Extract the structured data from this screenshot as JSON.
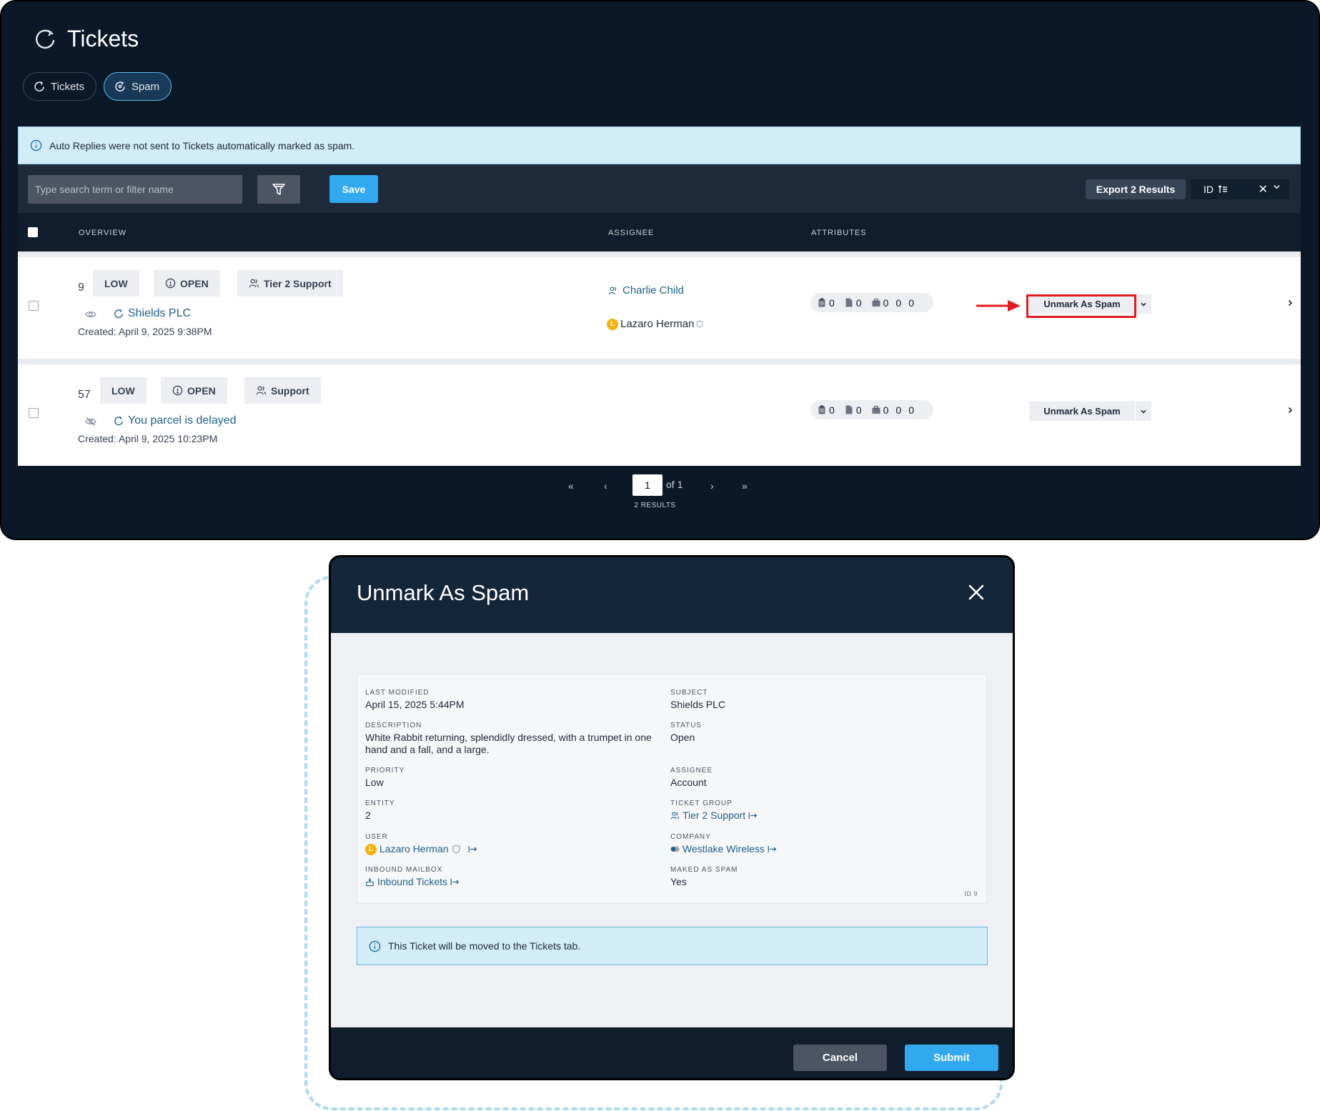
{
  "page": {
    "title": "Tickets"
  },
  "tabs": [
    {
      "label": "Tickets",
      "active": false
    },
    {
      "label": "Spam",
      "active": true
    }
  ],
  "banner": {
    "text": "Auto Replies were not sent to Tickets automatically marked as spam."
  },
  "toolbar": {
    "search_placeholder": "Type search term or filter name",
    "save_label": "Save",
    "export_label": "Export 2 Results",
    "sort_label": "ID"
  },
  "table": {
    "columns": {
      "overview": "OVERVIEW",
      "assignee": "ASSIGNEE",
      "attributes": "ATTRIBUTES"
    },
    "rows": [
      {
        "id": "9",
        "priority": "LOW",
        "status": "OPEN",
        "group": "Tier 2 Support",
        "subject": "Shields PLC",
        "created": "Created: April 9, 2025 9:38PM",
        "assignee": "Charlie Child",
        "user": "Lazaro Herman",
        "user_initial": "L",
        "attr": [
          "0",
          "0",
          "0",
          "0",
          "0"
        ],
        "action": "Unmark As Spam"
      },
      {
        "id": "57",
        "priority": "LOW",
        "status": "OPEN",
        "group": "Support",
        "subject": "You parcel is delayed",
        "created": "Created: April 9, 2025 10:23PM",
        "attr": [
          "0",
          "0",
          "0",
          "0",
          "0"
        ],
        "action": "Unmark As Spam"
      }
    ]
  },
  "pagination": {
    "page": "1",
    "of_label": "of 1",
    "results": "2 RESULTS"
  },
  "modal": {
    "title": "Unmark As Spam",
    "fields": {
      "last_modified": {
        "label": "LAST MODIFIED",
        "value": "April 15, 2025 5:44PM"
      },
      "subject": {
        "label": "SUBJECT",
        "value": "Shields PLC"
      },
      "description": {
        "label": "DESCRIPTION",
        "value": "White Rabbit returning, splendidly dressed, with a trumpet in one hand and a fall, and a large."
      },
      "status": {
        "label": "STATUS",
        "value": "Open"
      },
      "priority": {
        "label": "PRIORITY",
        "value": "Low"
      },
      "assignee": {
        "label": "ASSIGNEE",
        "value": "Account"
      },
      "entity": {
        "label": "ENTITY",
        "value": "2"
      },
      "ticket_group": {
        "label": "TICKET GROUP",
        "value": "Tier 2 Support"
      },
      "user": {
        "label": "USER",
        "value": "Lazaro Herman",
        "initial": "L"
      },
      "company": {
        "label": "COMPANY",
        "value": "Westlake Wireless"
      },
      "inbound_mailbox": {
        "label": "INBOUND MAILBOX",
        "value": "Inbound Tickets"
      },
      "marked_as_spam": {
        "label": "MAKED AS SPAM",
        "value": "Yes"
      }
    },
    "id_tag": "ID 9",
    "notice": "This Ticket will be moved to the Tickets tab.",
    "cancel_label": "Cancel",
    "submit_label": "Submit"
  },
  "colors": {
    "accent": "#32a8f0",
    "highlight": "#e01b22",
    "link": "#1f5f8b",
    "user_badge": "#f2b10e"
  }
}
